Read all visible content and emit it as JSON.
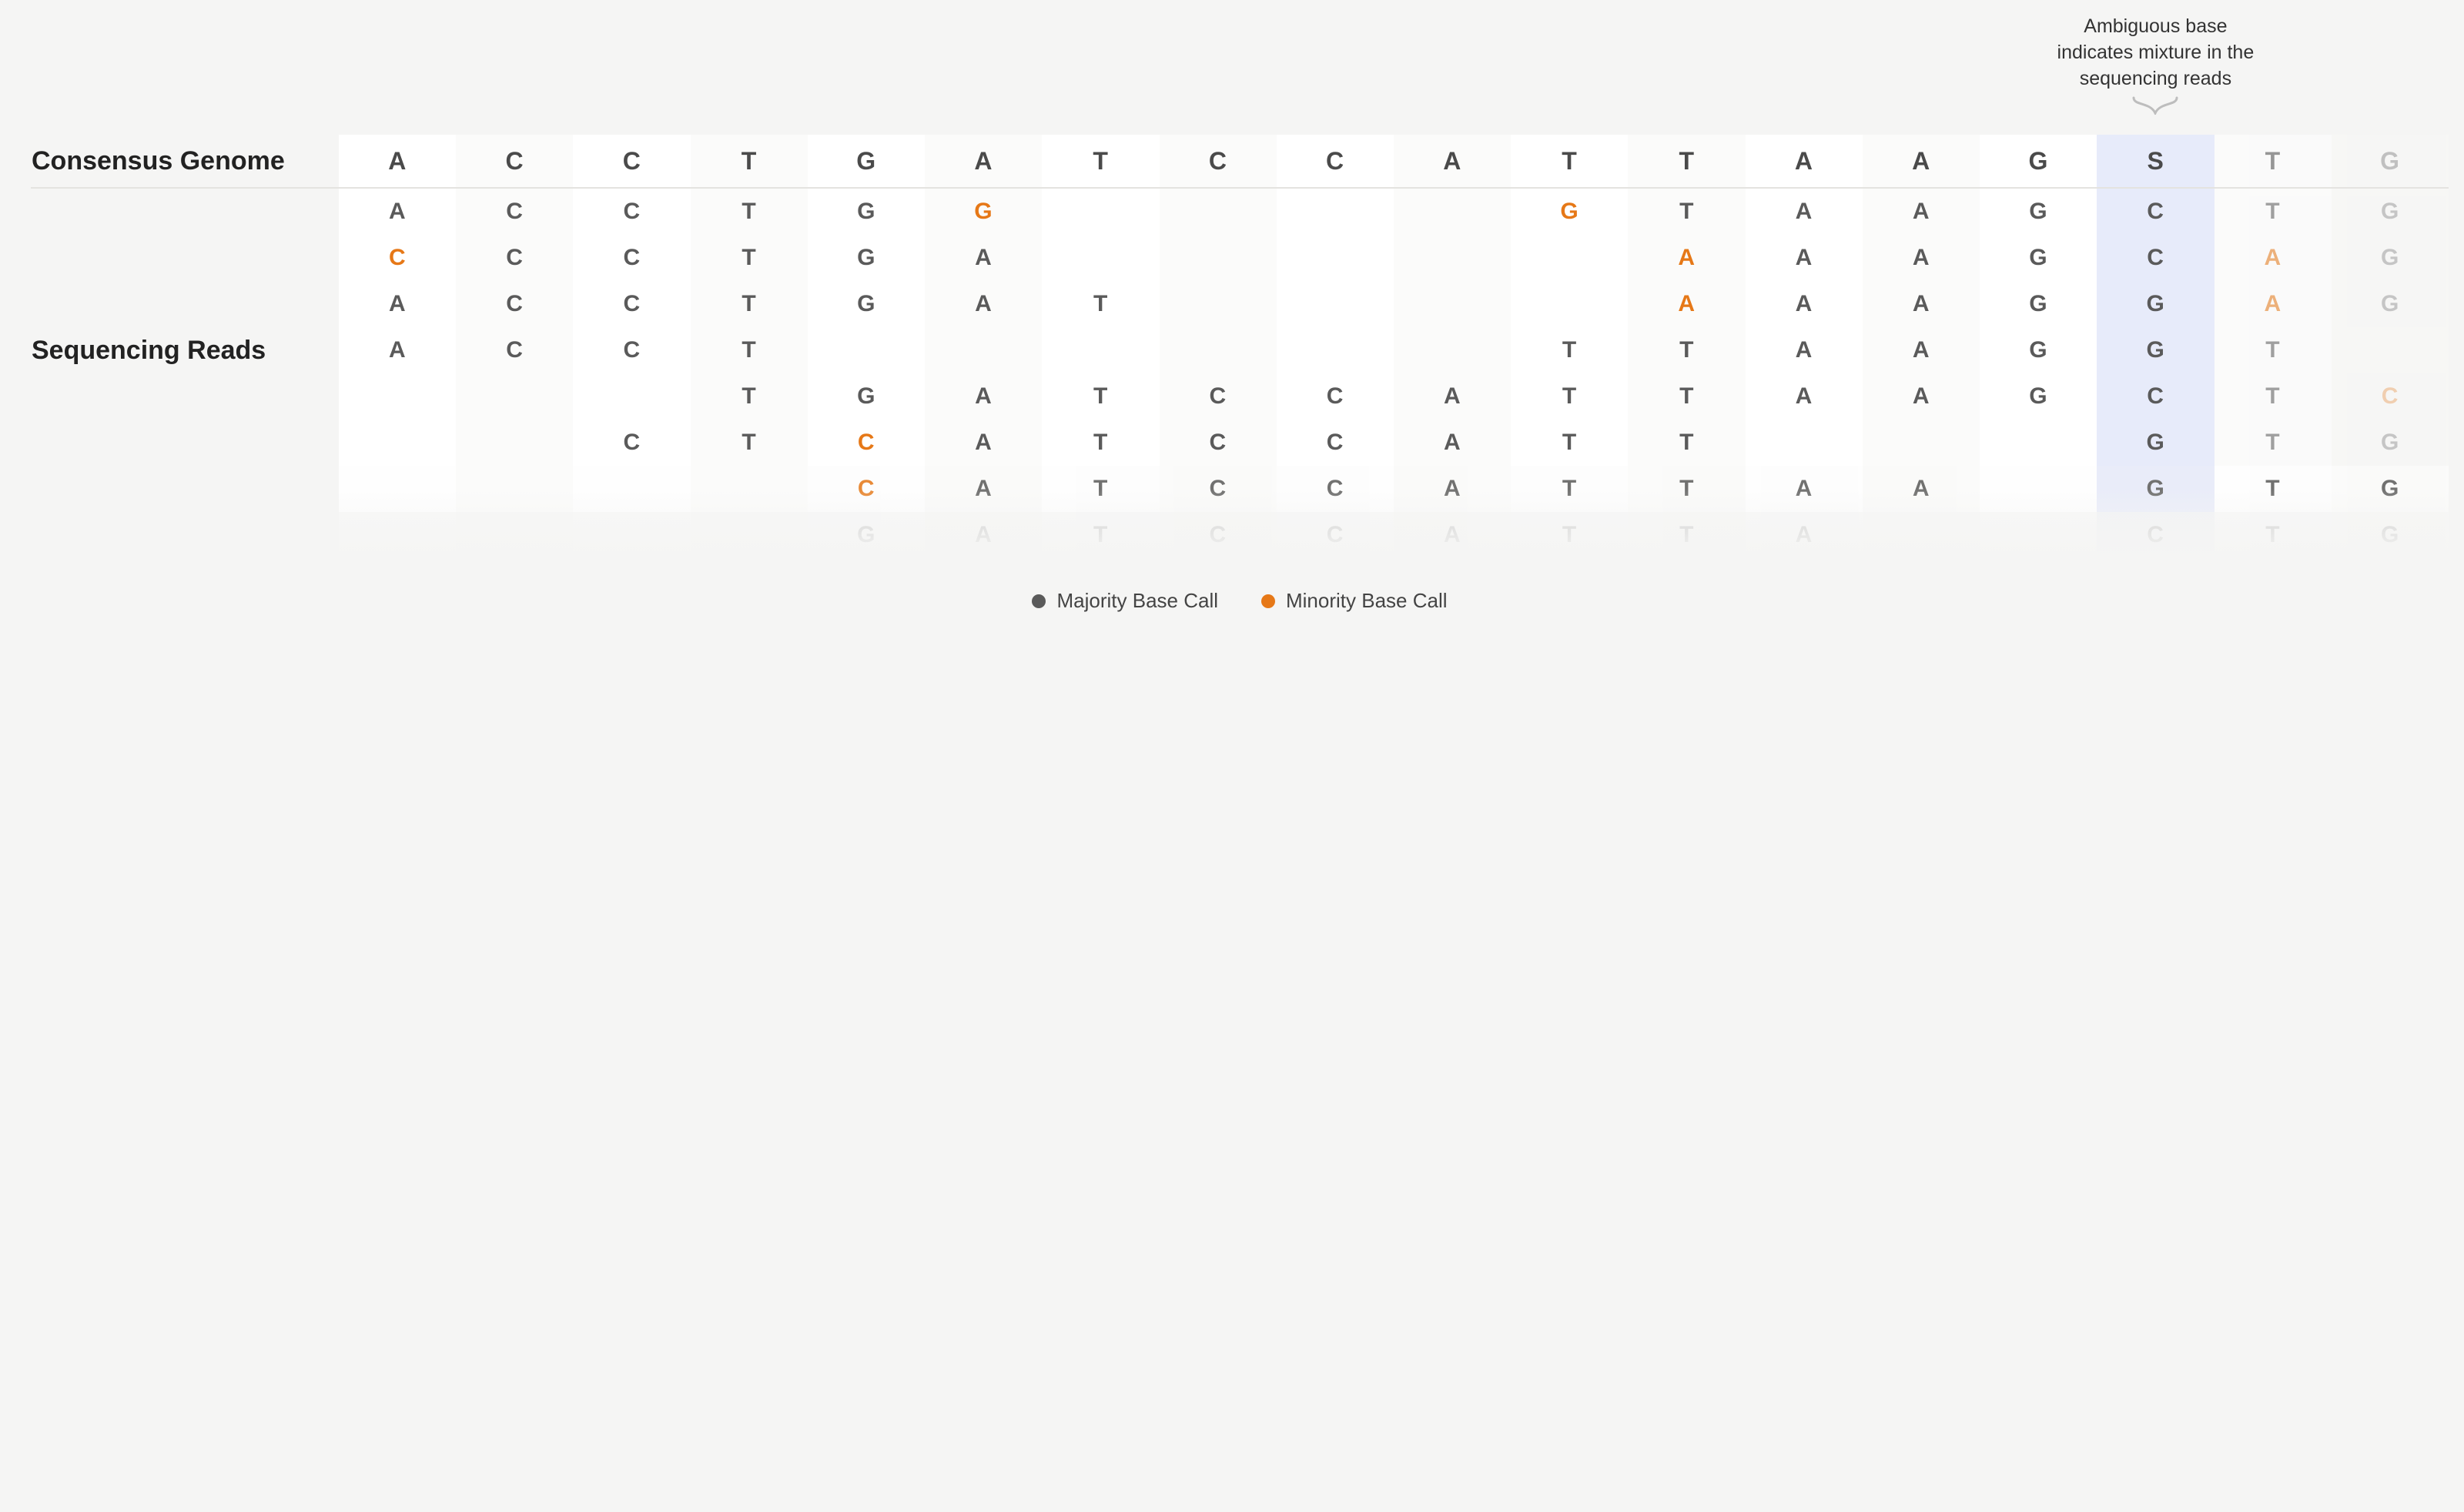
{
  "labels": {
    "consensus": "Consensus Genome",
    "reads": "Sequencing Reads"
  },
  "annotation": {
    "line1": "Ambiguous base",
    "line2": "indicates mixture in the",
    "line3": "sequencing reads"
  },
  "legend": {
    "majority": "Majority Base Call",
    "minority": "Minority Base Call"
  },
  "highlight_column_index": 15,
  "columns": 18,
  "consensus": [
    {
      "b": "A",
      "t": "majority"
    },
    {
      "b": "C",
      "t": "majority"
    },
    {
      "b": "C",
      "t": "majority"
    },
    {
      "b": "T",
      "t": "majority"
    },
    {
      "b": "G",
      "t": "majority"
    },
    {
      "b": "A",
      "t": "majority"
    },
    {
      "b": "T",
      "t": "majority"
    },
    {
      "b": "C",
      "t": "majority"
    },
    {
      "b": "C",
      "t": "majority"
    },
    {
      "b": "A",
      "t": "majority"
    },
    {
      "b": "T",
      "t": "majority"
    },
    {
      "b": "T",
      "t": "majority"
    },
    {
      "b": "A",
      "t": "majority"
    },
    {
      "b": "A",
      "t": "majority"
    },
    {
      "b": "G",
      "t": "majority"
    },
    {
      "b": "S",
      "t": "ambiguous"
    },
    {
      "b": "T",
      "t": "majority"
    },
    {
      "b": "G",
      "t": "majority"
    }
  ],
  "reads": [
    [
      {
        "b": "A",
        "t": "majority"
      },
      {
        "b": "C",
        "t": "majority"
      },
      {
        "b": "C",
        "t": "majority"
      },
      {
        "b": "T",
        "t": "majority"
      },
      {
        "b": "G",
        "t": "majority"
      },
      {
        "b": "G",
        "t": "minority"
      },
      {
        "b": "",
        "t": "empty"
      },
      {
        "b": "",
        "t": "empty"
      },
      {
        "b": "",
        "t": "empty"
      },
      {
        "b": "",
        "t": "empty"
      },
      {
        "b": "G",
        "t": "minority"
      },
      {
        "b": "T",
        "t": "majority"
      },
      {
        "b": "A",
        "t": "majority"
      },
      {
        "b": "A",
        "t": "majority"
      },
      {
        "b": "G",
        "t": "majority"
      },
      {
        "b": "C",
        "t": "majority"
      },
      {
        "b": "T",
        "t": "majority"
      },
      {
        "b": "G",
        "t": "majority"
      }
    ],
    [
      {
        "b": "C",
        "t": "minority"
      },
      {
        "b": "C",
        "t": "majority"
      },
      {
        "b": "C",
        "t": "majority"
      },
      {
        "b": "T",
        "t": "majority"
      },
      {
        "b": "G",
        "t": "majority"
      },
      {
        "b": "A",
        "t": "majority"
      },
      {
        "b": "",
        "t": "empty"
      },
      {
        "b": "",
        "t": "empty"
      },
      {
        "b": "",
        "t": "empty"
      },
      {
        "b": "",
        "t": "empty"
      },
      {
        "b": "",
        "t": "empty"
      },
      {
        "b": "A",
        "t": "minority"
      },
      {
        "b": "A",
        "t": "majority"
      },
      {
        "b": "A",
        "t": "majority"
      },
      {
        "b": "G",
        "t": "majority"
      },
      {
        "b": "C",
        "t": "majority"
      },
      {
        "b": "A",
        "t": "minority"
      },
      {
        "b": "G",
        "t": "majority"
      }
    ],
    [
      {
        "b": "A",
        "t": "majority"
      },
      {
        "b": "C",
        "t": "majority"
      },
      {
        "b": "C",
        "t": "majority"
      },
      {
        "b": "T",
        "t": "majority"
      },
      {
        "b": "G",
        "t": "majority"
      },
      {
        "b": "A",
        "t": "majority"
      },
      {
        "b": "T",
        "t": "majority"
      },
      {
        "b": "",
        "t": "empty"
      },
      {
        "b": "",
        "t": "empty"
      },
      {
        "b": "",
        "t": "empty"
      },
      {
        "b": "",
        "t": "empty"
      },
      {
        "b": "A",
        "t": "minority"
      },
      {
        "b": "A",
        "t": "majority"
      },
      {
        "b": "A",
        "t": "majority"
      },
      {
        "b": "G",
        "t": "majority"
      },
      {
        "b": "G",
        "t": "majority"
      },
      {
        "b": "A",
        "t": "minority"
      },
      {
        "b": "G",
        "t": "majority"
      }
    ],
    [
      {
        "b": "A",
        "t": "majority"
      },
      {
        "b": "C",
        "t": "majority"
      },
      {
        "b": "C",
        "t": "majority"
      },
      {
        "b": "T",
        "t": "majority"
      },
      {
        "b": "",
        "t": "empty"
      },
      {
        "b": "",
        "t": "empty"
      },
      {
        "b": "",
        "t": "empty"
      },
      {
        "b": "",
        "t": "empty"
      },
      {
        "b": "",
        "t": "empty"
      },
      {
        "b": "",
        "t": "empty"
      },
      {
        "b": "T",
        "t": "majority"
      },
      {
        "b": "T",
        "t": "majority"
      },
      {
        "b": "A",
        "t": "majority"
      },
      {
        "b": "A",
        "t": "majority"
      },
      {
        "b": "G",
        "t": "majority"
      },
      {
        "b": "G",
        "t": "majority"
      },
      {
        "b": "T",
        "t": "majority"
      },
      {
        "b": "",
        "t": "empty"
      }
    ],
    [
      {
        "b": "",
        "t": "empty"
      },
      {
        "b": "",
        "t": "empty"
      },
      {
        "b": "",
        "t": "empty"
      },
      {
        "b": "T",
        "t": "majority"
      },
      {
        "b": "G",
        "t": "majority"
      },
      {
        "b": "A",
        "t": "majority"
      },
      {
        "b": "T",
        "t": "majority"
      },
      {
        "b": "C",
        "t": "majority"
      },
      {
        "b": "C",
        "t": "majority"
      },
      {
        "b": "A",
        "t": "majority"
      },
      {
        "b": "T",
        "t": "majority"
      },
      {
        "b": "T",
        "t": "majority"
      },
      {
        "b": "A",
        "t": "majority"
      },
      {
        "b": "A",
        "t": "majority"
      },
      {
        "b": "G",
        "t": "majority"
      },
      {
        "b": "C",
        "t": "majority"
      },
      {
        "b": "T",
        "t": "majority"
      },
      {
        "b": "C",
        "t": "minority"
      }
    ],
    [
      {
        "b": "",
        "t": "empty"
      },
      {
        "b": "",
        "t": "empty"
      },
      {
        "b": "C",
        "t": "majority"
      },
      {
        "b": "T",
        "t": "majority"
      },
      {
        "b": "C",
        "t": "minority"
      },
      {
        "b": "A",
        "t": "majority"
      },
      {
        "b": "T",
        "t": "majority"
      },
      {
        "b": "C",
        "t": "majority"
      },
      {
        "b": "C",
        "t": "majority"
      },
      {
        "b": "A",
        "t": "majority"
      },
      {
        "b": "T",
        "t": "majority"
      },
      {
        "b": "T",
        "t": "majority"
      },
      {
        "b": "",
        "t": "empty"
      },
      {
        "b": "",
        "t": "empty"
      },
      {
        "b": "",
        "t": "empty"
      },
      {
        "b": "G",
        "t": "majority"
      },
      {
        "b": "T",
        "t": "majority"
      },
      {
        "b": "G",
        "t": "majority"
      }
    ],
    [
      {
        "b": "",
        "t": "empty"
      },
      {
        "b": "",
        "t": "empty"
      },
      {
        "b": "",
        "t": "empty"
      },
      {
        "b": "",
        "t": "empty"
      },
      {
        "b": "C",
        "t": "minority"
      },
      {
        "b": "A",
        "t": "majority"
      },
      {
        "b": "T",
        "t": "majority"
      },
      {
        "b": "C",
        "t": "majority"
      },
      {
        "b": "C",
        "t": "majority"
      },
      {
        "b": "A",
        "t": "majority"
      },
      {
        "b": "T",
        "t": "majority"
      },
      {
        "b": "T",
        "t": "majority"
      },
      {
        "b": "A",
        "t": "majority"
      },
      {
        "b": "A",
        "t": "majority"
      },
      {
        "b": "",
        "t": "empty"
      },
      {
        "b": "G",
        "t": "majority"
      },
      {
        "b": "T",
        "t": "majority"
      },
      {
        "b": "G",
        "t": "majority"
      }
    ],
    [
      {
        "b": "",
        "t": "empty"
      },
      {
        "b": "",
        "t": "empty"
      },
      {
        "b": "",
        "t": "empty"
      },
      {
        "b": "",
        "t": "empty"
      },
      {
        "b": "G",
        "t": "majority"
      },
      {
        "b": "A",
        "t": "majority"
      },
      {
        "b": "T",
        "t": "majority"
      },
      {
        "b": "C",
        "t": "majority"
      },
      {
        "b": "C",
        "t": "majority"
      },
      {
        "b": "A",
        "t": "majority"
      },
      {
        "b": "T",
        "t": "majority"
      },
      {
        "b": "T",
        "t": "majority"
      },
      {
        "b": "A",
        "t": "majority"
      },
      {
        "b": "",
        "t": "empty"
      },
      {
        "b": "",
        "t": "empty"
      },
      {
        "b": "C",
        "t": "majority"
      },
      {
        "b": "T",
        "t": "majority"
      },
      {
        "b": "G",
        "t": "majority"
      }
    ]
  ]
}
